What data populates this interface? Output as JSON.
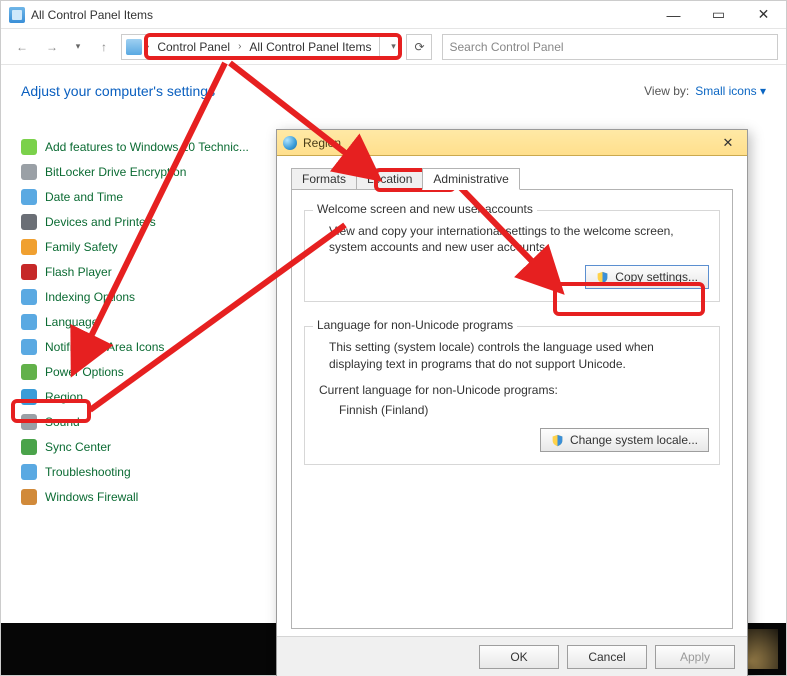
{
  "window": {
    "title": "All Control Panel Items",
    "min_icon": "—",
    "max_icon": "▭",
    "close_icon": "✕"
  },
  "nav": {
    "back_icon": "←",
    "fwd_icon": "→",
    "dd_icon": "▾",
    "up_icon": "↑",
    "chev": "›",
    "refresh_icon": "⟳",
    "path_dd_icon": "▾",
    "search_placeholder": "Search Control Panel",
    "crumbs": [
      "Control Panel",
      "All Control Panel Items"
    ]
  },
  "content": {
    "heading": "Adjust your computer's settings",
    "viewby_label": "View by:",
    "viewby_value": "Small icons",
    "viewby_dd": "▾"
  },
  "items": [
    {
      "label": "Add features to Windows 10 Technic...",
      "color": "#7bd14b"
    },
    {
      "label": "BitLocker Drive Encryption",
      "color": "#9aa0a6"
    },
    {
      "label": "Date and Time",
      "color": "#5aa9e2"
    },
    {
      "label": "Devices and Printers",
      "color": "#6b6f76"
    },
    {
      "label": "Family Safety",
      "color": "#f0a030"
    },
    {
      "label": "Flash Player",
      "color": "#c62828"
    },
    {
      "label": "Indexing Options",
      "color": "#5aa9e2"
    },
    {
      "label": "Language",
      "color": "#5aa9e2"
    },
    {
      "label": "Notification Area Icons",
      "color": "#5aa9e2"
    },
    {
      "label": "Power Options",
      "color": "#62b14a"
    },
    {
      "label": "Region",
      "color": "#3a9cd8"
    },
    {
      "label": "Sound",
      "color": "#9aa0a6"
    },
    {
      "label": "Sync Center",
      "color": "#4aa34a"
    },
    {
      "label": "Troubleshooting",
      "color": "#5aa9e2"
    },
    {
      "label": "Windows Firewall",
      "color": "#d18a3a"
    }
  ],
  "dialog": {
    "title": "Region",
    "close_icon": "✕",
    "tabs": [
      "Formats",
      "Location",
      "Administrative"
    ],
    "group1": {
      "legend": "Welcome screen and new user accounts",
      "desc": "View and copy your international settings to the welcome screen, system accounts and new user accounts.",
      "button": "Copy settings..."
    },
    "group2": {
      "legend": "Language for non-Unicode programs",
      "desc": "This setting (system locale) controls the language used when displaying text in programs that do not support Unicode.",
      "current_label": "Current language for non-Unicode programs:",
      "current_value": "Finnish (Finland)",
      "button": "Change system locale..."
    },
    "footer": {
      "ok": "OK",
      "cancel": "Cancel",
      "apply": "Apply"
    }
  }
}
